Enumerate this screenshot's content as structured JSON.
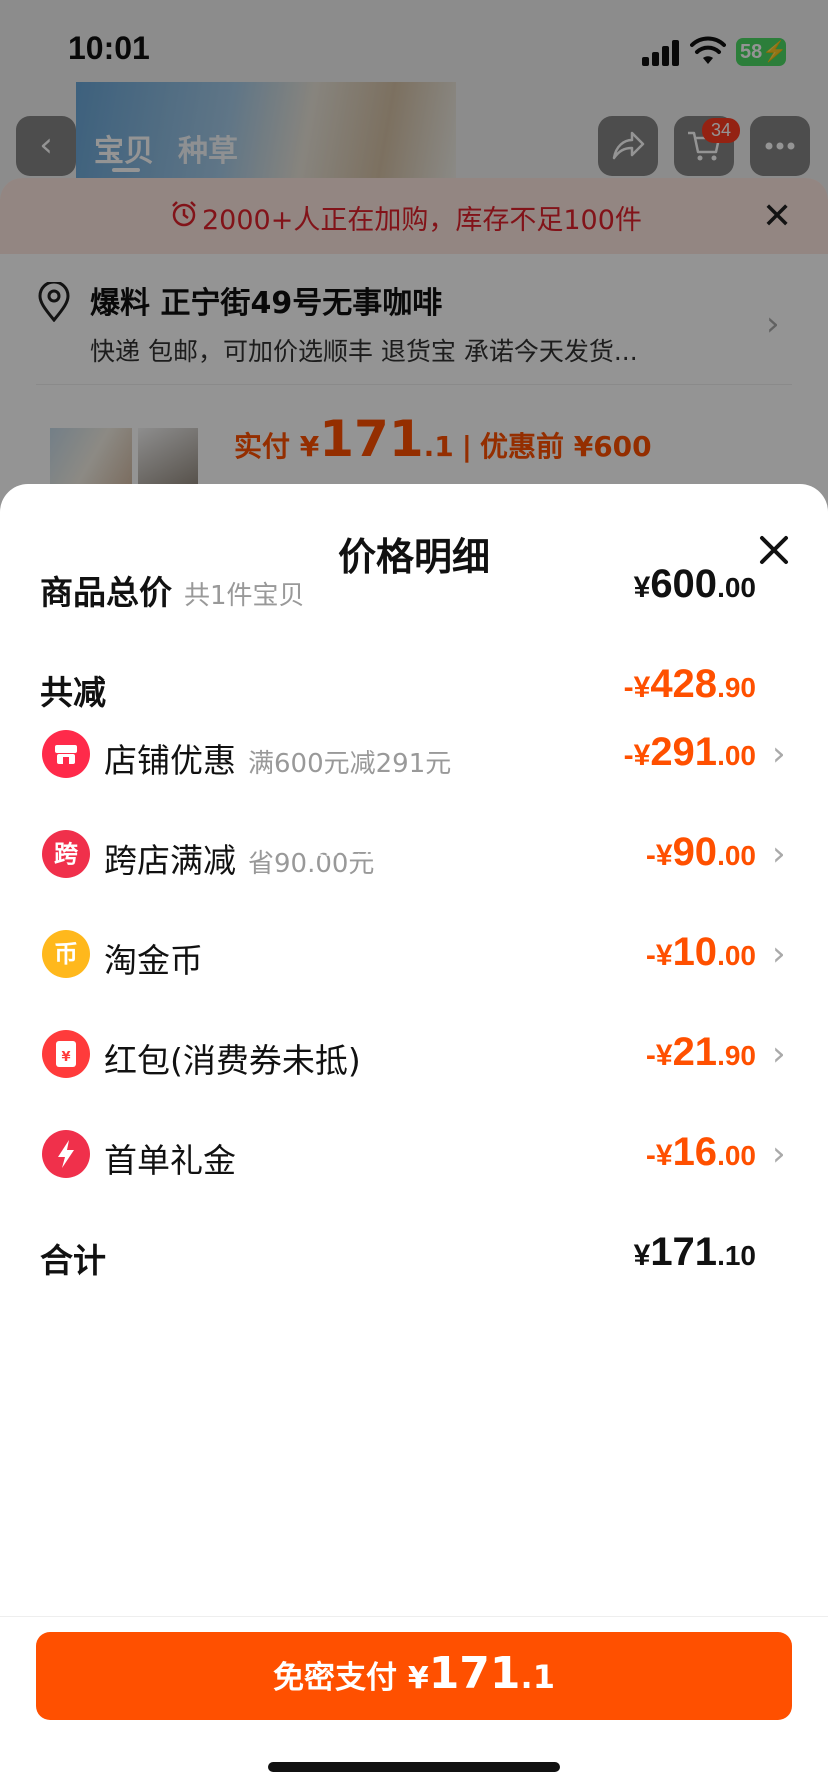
{
  "status_bar": {
    "time": "10:01",
    "battery": "58"
  },
  "nav": {
    "tabs": [
      "宝贝",
      "种草"
    ],
    "cart_count": "34"
  },
  "background": {
    "stock_banner": "2000+人正在加购，库存不足100件",
    "address_title": "爆料 正宁街49号无事咖啡",
    "address_sub": "快递 包邮，可加价选顺丰 退货宝 承诺今天发货...",
    "price_label": "实付 ¥",
    "price_int": "171",
    "price_dec": ".1",
    "price_sep": "|",
    "before_label": "优惠前 ¥600"
  },
  "sheet": {
    "title": "价格明细",
    "rows": [
      {
        "label": "商品总价",
        "sub": "共1件宝贝",
        "sym": "¥",
        "int": "600",
        "dec": ".00"
      },
      {
        "label": "共减",
        "sub": "",
        "sym": "-¥",
        "int": "428",
        "dec": ".90"
      },
      {
        "label": "店铺优惠",
        "sub": "满600元减291元",
        "sym": "-¥",
        "int": "291",
        "dec": ".00",
        "icon_text": ""
      },
      {
        "label": "跨店满减",
        "sub": "省90.00元",
        "sym": "-¥",
        "int": "90",
        "dec": ".00",
        "icon_text": "跨"
      },
      {
        "label": "淘金币",
        "sub": "",
        "sym": "-¥",
        "int": "10",
        "dec": ".00",
        "icon_text": "币"
      },
      {
        "label": "红包(消费券未抵)",
        "sub": "",
        "sym": "-¥",
        "int": "21",
        "dec": ".90",
        "icon_text": "¥"
      },
      {
        "label": "首单礼金",
        "sub": "",
        "sym": "-¥",
        "int": "16",
        "dec": ".00",
        "icon_text": ""
      },
      {
        "label": "合计",
        "sub": "",
        "sym": "¥",
        "int": "171",
        "dec": ".10"
      }
    ],
    "arrow": "›",
    "watermark": "tb0s4ge01"
  },
  "pay_button": {
    "label": "免密支付 ",
    "sym": "¥",
    "int": "171",
    "dec": ".1"
  },
  "colors": {
    "accent": "#ff5000",
    "red": "#e0222b"
  },
  "icons": [
    "back-icon",
    "share-icon",
    "cart-icon",
    "more-icon",
    "alarm-icon",
    "location-pin-icon",
    "close-icon",
    "shop-icon",
    "cross-store-icon",
    "coin-icon",
    "red-packet-icon",
    "lightning-icon",
    "chevron-right-icon"
  ]
}
